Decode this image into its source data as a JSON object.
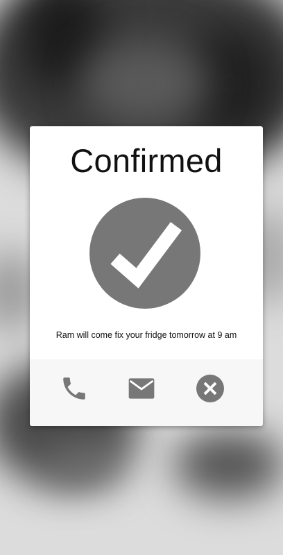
{
  "dialog": {
    "title": "Confirmed",
    "message": "Ram will come fix your fridge tomorrow at 9 am",
    "status_icon": "check-circle-icon"
  },
  "actions": [
    {
      "name": "phone-icon"
    },
    {
      "name": "mail-icon"
    },
    {
      "name": "close-icon"
    }
  ],
  "colors": {
    "icon_gray": "#777777",
    "dialog_bg": "#ffffff",
    "actions_bg": "#f7f7f7"
  }
}
